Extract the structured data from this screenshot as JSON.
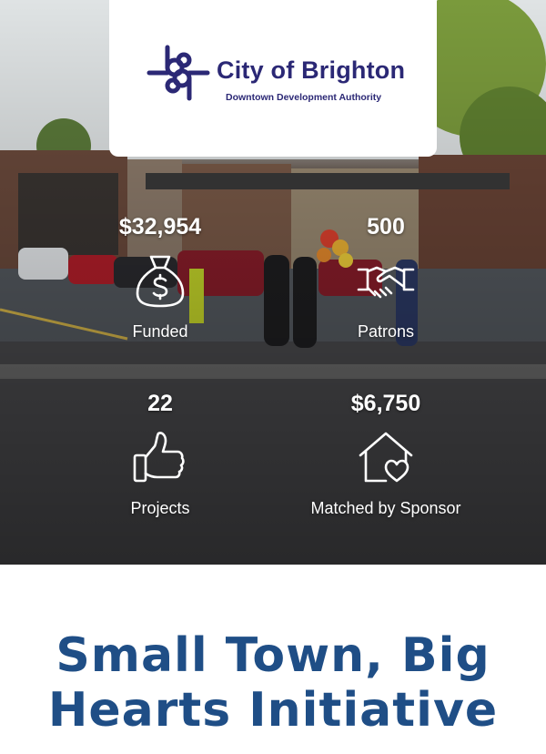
{
  "logo": {
    "title": "City of Brighton",
    "subtitle": "Downtown Development Authority",
    "mark_color": "#2b2875"
  },
  "stats": [
    {
      "value": "$32,954",
      "label": "Funded",
      "icon": "money-bag-icon"
    },
    {
      "value": "500",
      "label": "Patrons",
      "icon": "handshake-icon"
    },
    {
      "value": "22",
      "label": "Projects",
      "icon": "thumbs-up-icon"
    },
    {
      "value": "$6,750",
      "label": "Matched by Sponsor",
      "icon": "house-heart-icon"
    }
  ],
  "headline": {
    "line1": "Small Town, Big",
    "line2": "Hearts Initiative",
    "color": "#1f4e86"
  }
}
